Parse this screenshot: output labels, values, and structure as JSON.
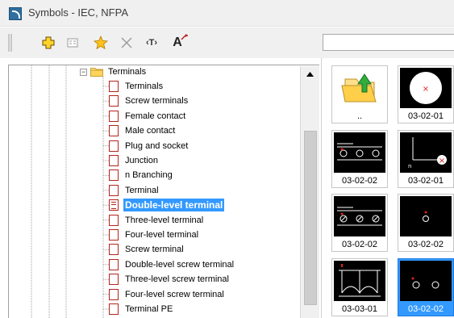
{
  "window": {
    "title": "Symbols - IEC, NFPA"
  },
  "toolbar": {
    "buttons": [
      {
        "name": "add-button",
        "icon": "plus-icon"
      },
      {
        "name": "properties-button",
        "icon": "properties-icon"
      },
      {
        "name": "favorite-button",
        "icon": "star-icon"
      },
      {
        "name": "delete-button",
        "icon": "x-icon"
      },
      {
        "name": "text-button",
        "icon": "text-cursor-icon"
      },
      {
        "name": "font-button",
        "icon": "font-icon"
      }
    ],
    "text_button_label": "‹T›",
    "font_button_label": "A",
    "search_value": ""
  },
  "tree": {
    "folder_label": "Terminals",
    "items": [
      {
        "label": "Terminals",
        "selected": false
      },
      {
        "label": "Screw terminals",
        "selected": false
      },
      {
        "label": "Female contact",
        "selected": false
      },
      {
        "label": "Male contact",
        "selected": false
      },
      {
        "label": "Plug and socket",
        "selected": false
      },
      {
        "label": "Junction",
        "selected": false
      },
      {
        "label": "n Branching",
        "selected": false
      },
      {
        "label": "Terminal",
        "selected": false
      },
      {
        "label": "Double-level terminal",
        "selected": true
      },
      {
        "label": "Three-level terminal",
        "selected": false
      },
      {
        "label": "Four-level terminal",
        "selected": false
      },
      {
        "label": "Screw terminal",
        "selected": false
      },
      {
        "label": "Double-level screw terminal",
        "selected": false
      },
      {
        "label": "Three-level screw terminal",
        "selected": false
      },
      {
        "label": "Four-level screw terminal",
        "selected": false
      },
      {
        "label": "Terminal PE",
        "selected": false
      }
    ]
  },
  "grid": {
    "tiles": [
      {
        "caption": "..",
        "kind": "folder-up",
        "selected": false
      },
      {
        "caption": "03-02-01",
        "kind": "circle-x",
        "selected": false
      },
      {
        "caption": "03-02-02",
        "kind": "three-circles",
        "selected": false
      },
      {
        "caption": "03-02-01",
        "kind": "corner-x",
        "selected": false
      },
      {
        "caption": "03-02-02",
        "kind": "three-circles-slash",
        "selected": false
      },
      {
        "caption": "03-02-02",
        "kind": "single-circle",
        "selected": false
      },
      {
        "caption": "03-03-01",
        "kind": "arcs",
        "selected": false
      },
      {
        "caption": "03-02-02",
        "kind": "two-circles",
        "selected": true
      }
    ],
    "colors": {
      "selection": "#3399ff",
      "symbol_red": "#e02020"
    }
  }
}
